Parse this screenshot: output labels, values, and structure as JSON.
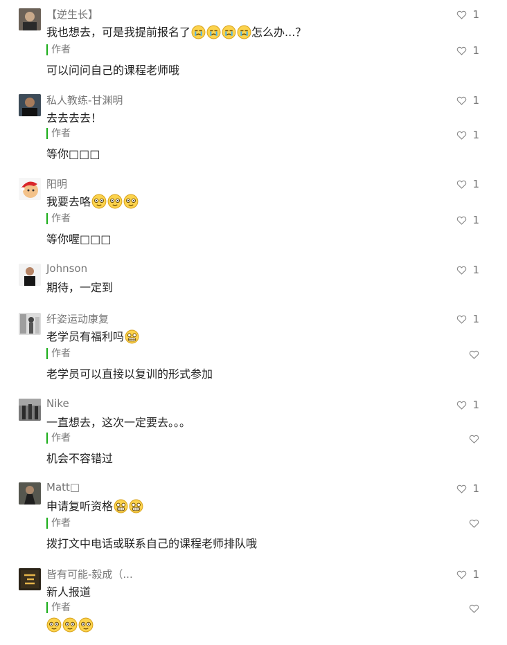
{
  "comments": [
    {
      "user": "【逆生长】",
      "text": "我也想去，可是我提前报名了",
      "text_tail": "怎么办...？",
      "likes": "1",
      "reply_label": "作者",
      "reply": "可以问问自己的课程老师哦",
      "reply_likes": "1",
      "emoji": "crying-face-icon",
      "emoji_count": 4
    },
    {
      "user": "私人教练-甘渊明",
      "text": "去去去去！",
      "likes": "1",
      "reply_label": "作者",
      "reply": "等你□□□",
      "reply_likes": "1"
    },
    {
      "user": "阳明",
      "text": "我要去咯",
      "likes": "1",
      "reply_label": "作者",
      "reply": "等你喔□□□",
      "reply_likes": "1",
      "emoji": "dazed-face-icon",
      "emoji_count": 3
    },
    {
      "user": "Johnson",
      "text": "期待，一定到",
      "likes": "1"
    },
    {
      "user": "纤姿运动康复",
      "text": "老学员有福利吗",
      "likes": "1",
      "reply_label": "作者",
      "reply": "老学员可以直接以复训的形式参加",
      "reply_likes": "",
      "emoji": "grinning-face-icon",
      "emoji_count": 1
    },
    {
      "user": "Nike",
      "text": "一直想去，这次一定要去。。。",
      "likes": "1",
      "reply_label": "作者",
      "reply": "机会不容错过",
      "reply_likes": ""
    },
    {
      "user": "Matt□",
      "text": "申请复听资格",
      "likes": "1",
      "reply_label": "作者",
      "reply": "拨打文中电话或联系自己的课程老师排队哦",
      "reply_likes": "",
      "emoji": "grinning-face-icon",
      "emoji_count": 2
    },
    {
      "user": "皆有可能-毅成（...",
      "text": "新人报道",
      "likes": "1",
      "reply_label": "作者",
      "reply": "",
      "reply_likes": "",
      "reply_emoji": "dazed-face-icon",
      "reply_emoji_count": 3
    }
  ]
}
